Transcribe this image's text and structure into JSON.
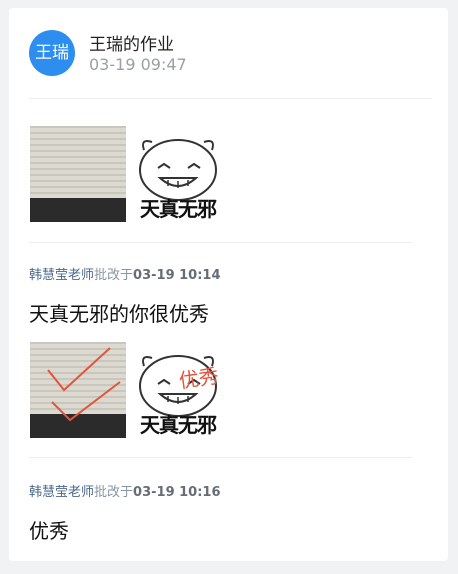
{
  "submission": {
    "avatar_text": "王瑞",
    "title": "王瑞的作业",
    "time": "03-19 09:47",
    "sticker_caption": "天真无邪"
  },
  "reviews": [
    {
      "teacher": "韩慧莹老师",
      "verb": "批改于",
      "time": "03-19 10:14",
      "comment": "天真无邪的你很优秀",
      "sticker_caption": "天真无邪",
      "sticker_annotation": "优秀"
    },
    {
      "teacher": "韩慧莹老师",
      "verb": "批改于",
      "time": "03-19 10:16",
      "comment": "优秀"
    }
  ],
  "colors": {
    "avatar_bg": "#2d8ef0",
    "teacher_name": "#4a6789",
    "annotation_red": "#e0553c"
  }
}
